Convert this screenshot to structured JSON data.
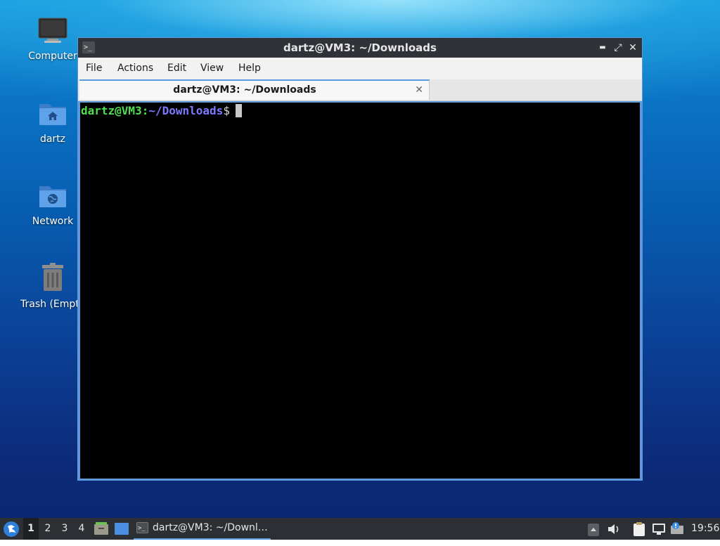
{
  "desktop": {
    "icons": [
      {
        "label": "Computer",
        "icon": "computer-icon"
      },
      {
        "label": "dartz",
        "icon": "home-folder-icon"
      },
      {
        "label": "Network",
        "icon": "network-folder-icon"
      },
      {
        "label": "Trash (Empty)",
        "icon": "trash-icon"
      }
    ]
  },
  "window": {
    "title": "dartz@VM3: ~/Downloads",
    "controls": {
      "minimize": "▬",
      "maximize": "⤢",
      "close": "✕"
    },
    "menu": [
      "File",
      "Actions",
      "Edit",
      "View",
      "Help"
    ],
    "tab": {
      "label": "dartz@VM3: ~/Downloads",
      "close": "✕"
    },
    "terminal": {
      "user_host": "dartz@VM3",
      "separator": ":",
      "path": "~/Downloads",
      "prompt_symbol": "$"
    }
  },
  "taskbar": {
    "workspaces": [
      "1",
      "2",
      "3",
      "4"
    ],
    "active_workspace": "1",
    "task": {
      "label": "dartz@VM3: ~/Downl…"
    },
    "clock": "19:56"
  },
  "colors": {
    "accent": "#5b9bdc",
    "prompt_user": "#4ee04e",
    "prompt_path": "#7a7aff",
    "titlebar": "#2f3237",
    "taskbar": "#2c2f33"
  }
}
